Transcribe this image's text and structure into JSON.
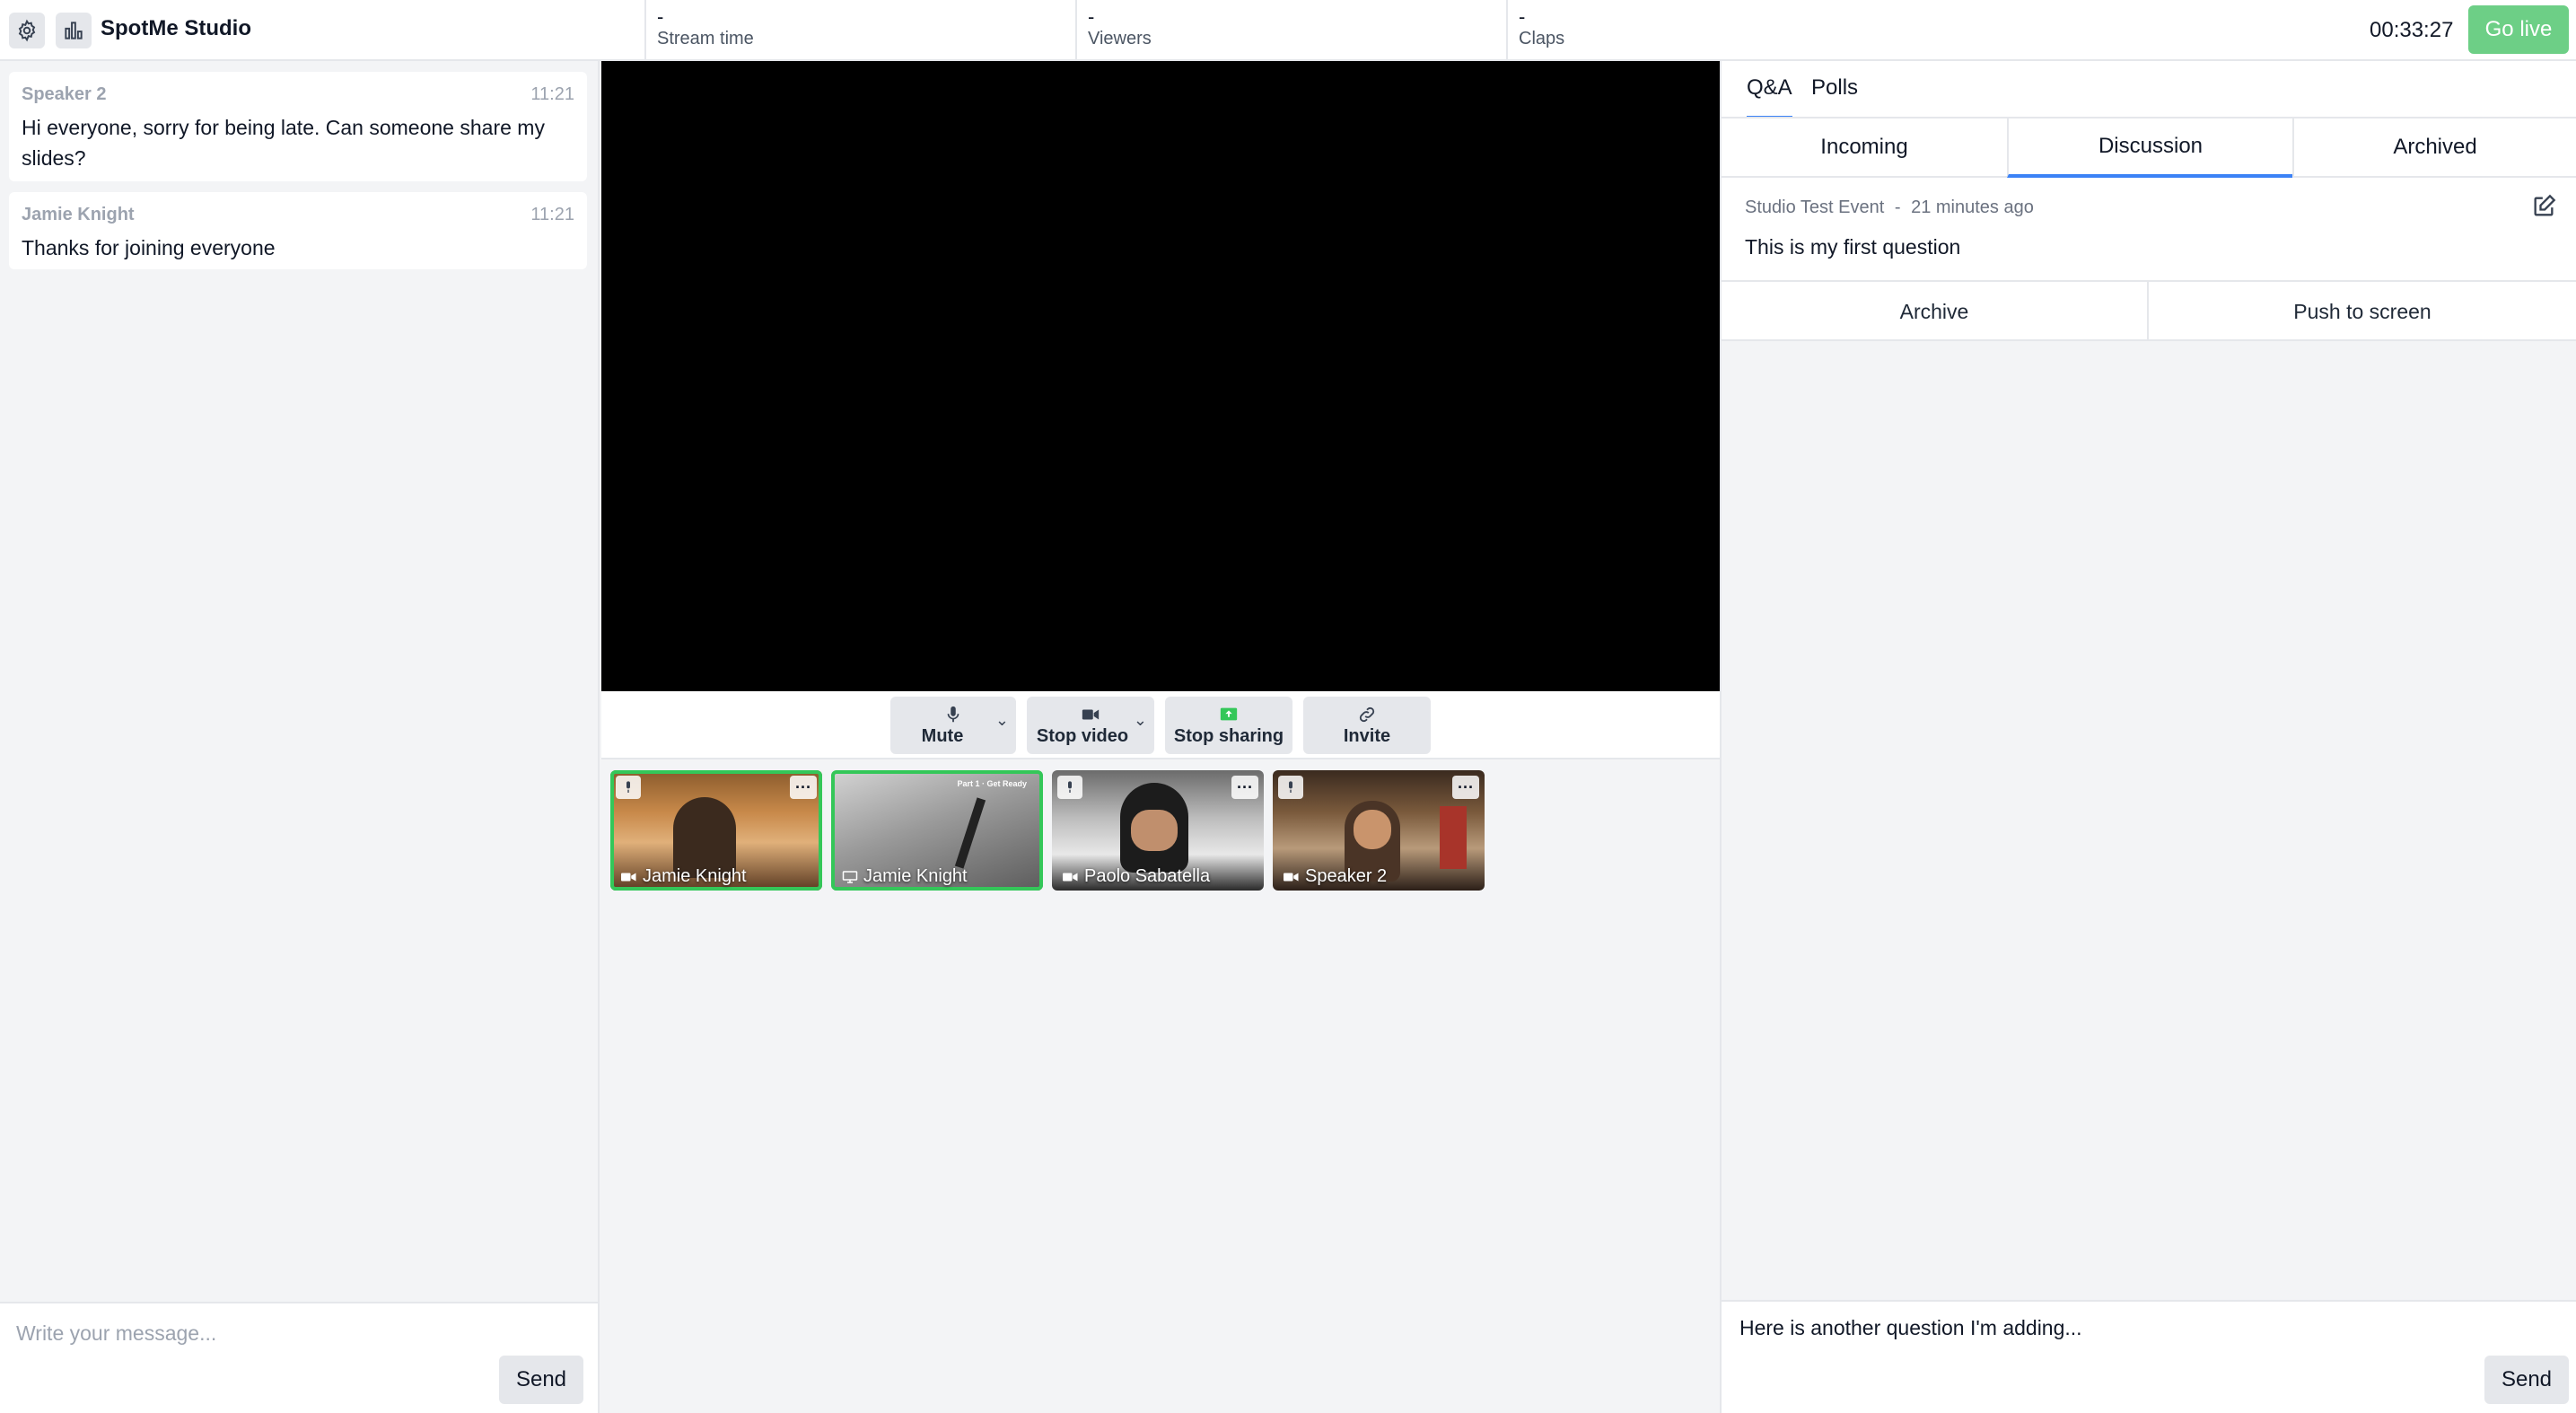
{
  "app": {
    "title": "SpotMe Studio"
  },
  "stats": [
    {
      "value": "-",
      "label": "Stream time"
    },
    {
      "value": "-",
      "label": "Viewers"
    },
    {
      "value": "-",
      "label": "Claps"
    }
  ],
  "clock": "00:33:27",
  "go_live_label": "Go live",
  "chat": {
    "messages": [
      {
        "author": "Speaker 2",
        "time": "11:21",
        "text": "Hi everyone, sorry for being late. Can someone share my slides?"
      },
      {
        "author": "Jamie Knight",
        "time": "11:21",
        "text": "Thanks for joining everyone"
      }
    ],
    "placeholder": "Write your message...",
    "send_label": "Send"
  },
  "controls": {
    "mute": "Mute",
    "stop_video": "Stop video",
    "stop_sharing": "Stop sharing",
    "invite": "Invite"
  },
  "participants": [
    {
      "name": "Jamie Knight",
      "kind": "camera",
      "active": true
    },
    {
      "name": "Jamie Knight",
      "kind": "screen",
      "active": true,
      "overlay_text": "Part 1 · Get Ready"
    },
    {
      "name": "Paolo Sabatella",
      "kind": "camera",
      "active": false
    },
    {
      "name": "Speaker 2",
      "kind": "camera",
      "active": false
    }
  ],
  "right_panel": {
    "tabs": [
      "Q&A",
      "Polls"
    ],
    "subtabs": [
      "Incoming",
      "Discussion",
      "Archived"
    ],
    "question": {
      "event": "Studio Test Event",
      "separator": "-",
      "age": "21 minutes ago",
      "text": "This is my first question"
    },
    "actions": {
      "archive": "Archive",
      "push": "Push to screen"
    },
    "composer_value": "Here is another question I'm adding...",
    "send_label": "Send"
  },
  "colors": {
    "accent": "#3b82f6",
    "live": "#6dcf86",
    "active_tile": "#34c759"
  }
}
